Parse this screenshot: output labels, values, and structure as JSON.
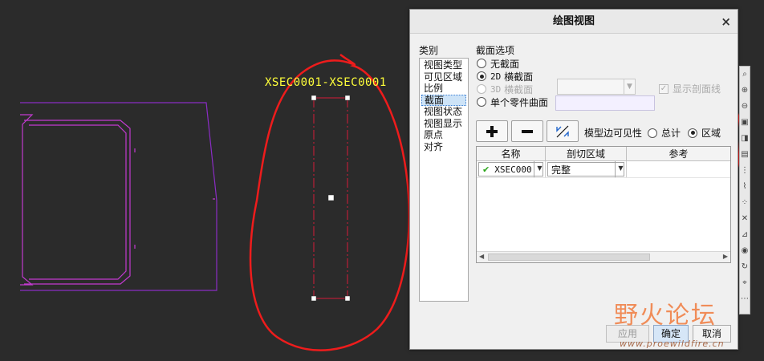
{
  "canvas": {
    "section_label": "XSEC0001-XSEC0001"
  },
  "dialog": {
    "title": "绘图视图",
    "close": "×",
    "category_label": "类别",
    "categories": [
      "视图类型",
      "可见区域",
      "比例",
      "截面",
      "视图状态",
      "视图显示",
      "原点",
      "对齐"
    ],
    "selected_category": "截面",
    "section_options_label": "截面选项",
    "radio_none": "无截面",
    "radio_2d_prefix": "2D",
    "radio_2d": "横截面",
    "radio_3d_prefix": "3D",
    "radio_3d": "横截面",
    "radio_single": "单个零件曲面",
    "show_hatching": "显示剖面线",
    "add_button": "+",
    "remove_button": "−",
    "model_edge_visibility": "模型边可见性",
    "vis_total": "总计",
    "vis_area": "区域",
    "table": {
      "headers": [
        "名称",
        "剖切区域",
        "参考"
      ],
      "rows": [
        {
          "name": "XSEC000",
          "area": "完整",
          "ref": ""
        }
      ]
    },
    "apply_button": "应用",
    "ok_button": "确定",
    "cancel_button": "取消"
  },
  "watermark": {
    "title": "野火论坛",
    "url": "www.proewildfire.cn"
  }
}
